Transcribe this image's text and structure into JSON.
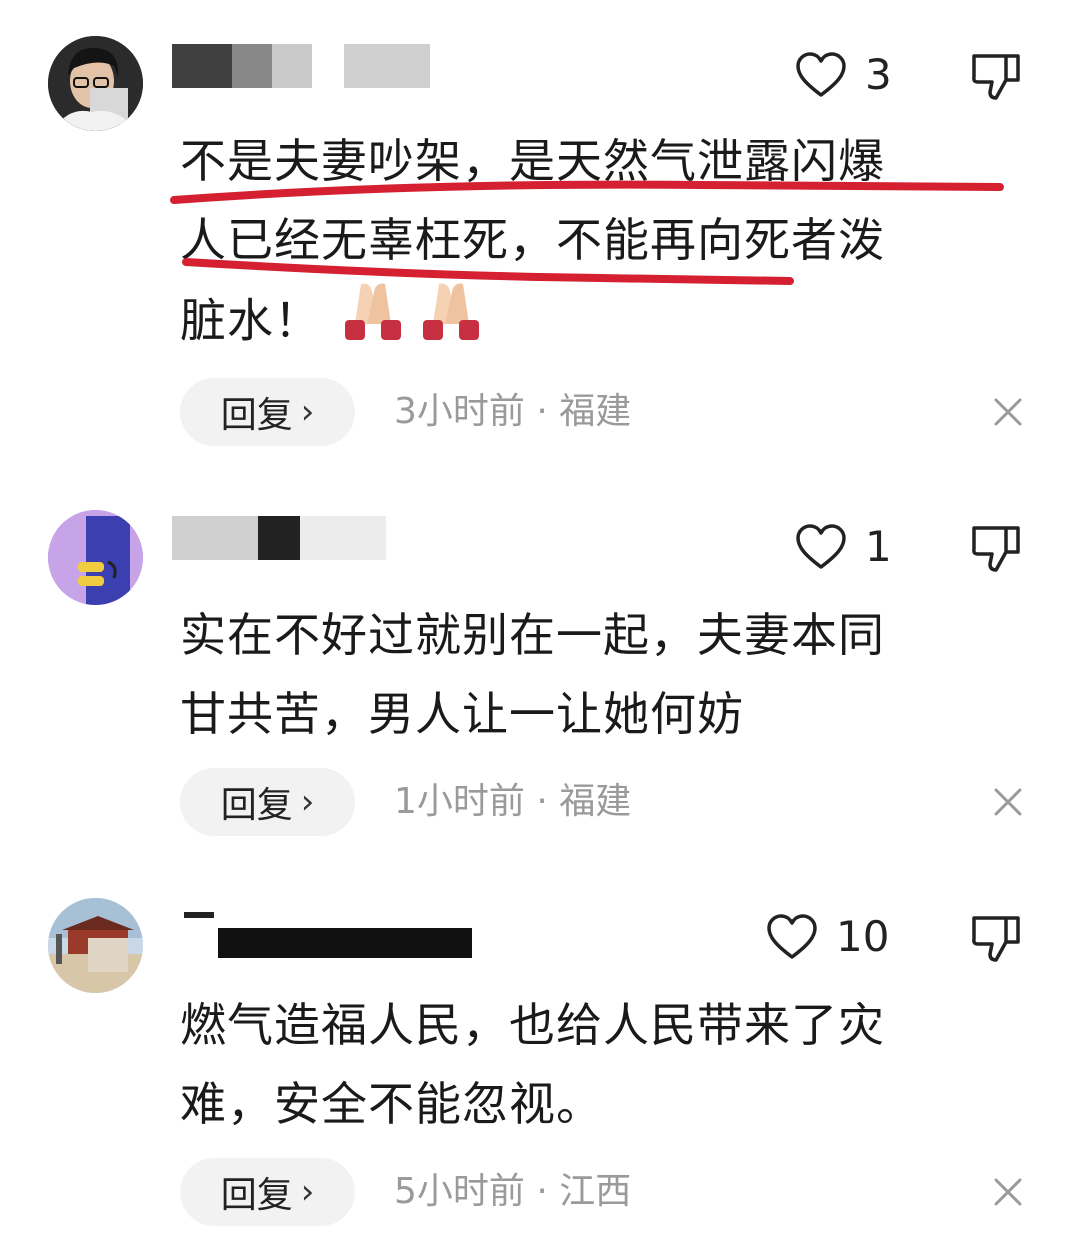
{
  "comments": [
    {
      "likes": "3",
      "text_lines": [
        "不是夫妻吵架，是天然气泄露闪爆",
        "人已经无辜枉死，不能再向死者泼",
        "脏水！"
      ],
      "emoji": "🙏🙏",
      "reply_label": "回复",
      "meta": "3小时前 · 福建"
    },
    {
      "likes": "1",
      "text_lines": [
        "实在不好过就别在一起，夫妻本同",
        "甘共苦，男人让一让她何妨"
      ],
      "reply_label": "回复",
      "meta": "1小时前 · 福建"
    },
    {
      "likes": "10",
      "text_lines": [
        "燃气造福人民，也给人民带来了灾",
        "难，安全不能忽视。"
      ],
      "reply_label": "回复",
      "meta": "5小时前 · 江西"
    }
  ],
  "colors": {
    "annotation": "#d42030",
    "meta": "#9a9a9a",
    "reply_bg": "#f2f2f2"
  },
  "icons": [
    "heart-outline-icon",
    "thumbs-down-icon",
    "close-icon",
    "chevron-right-icon"
  ]
}
